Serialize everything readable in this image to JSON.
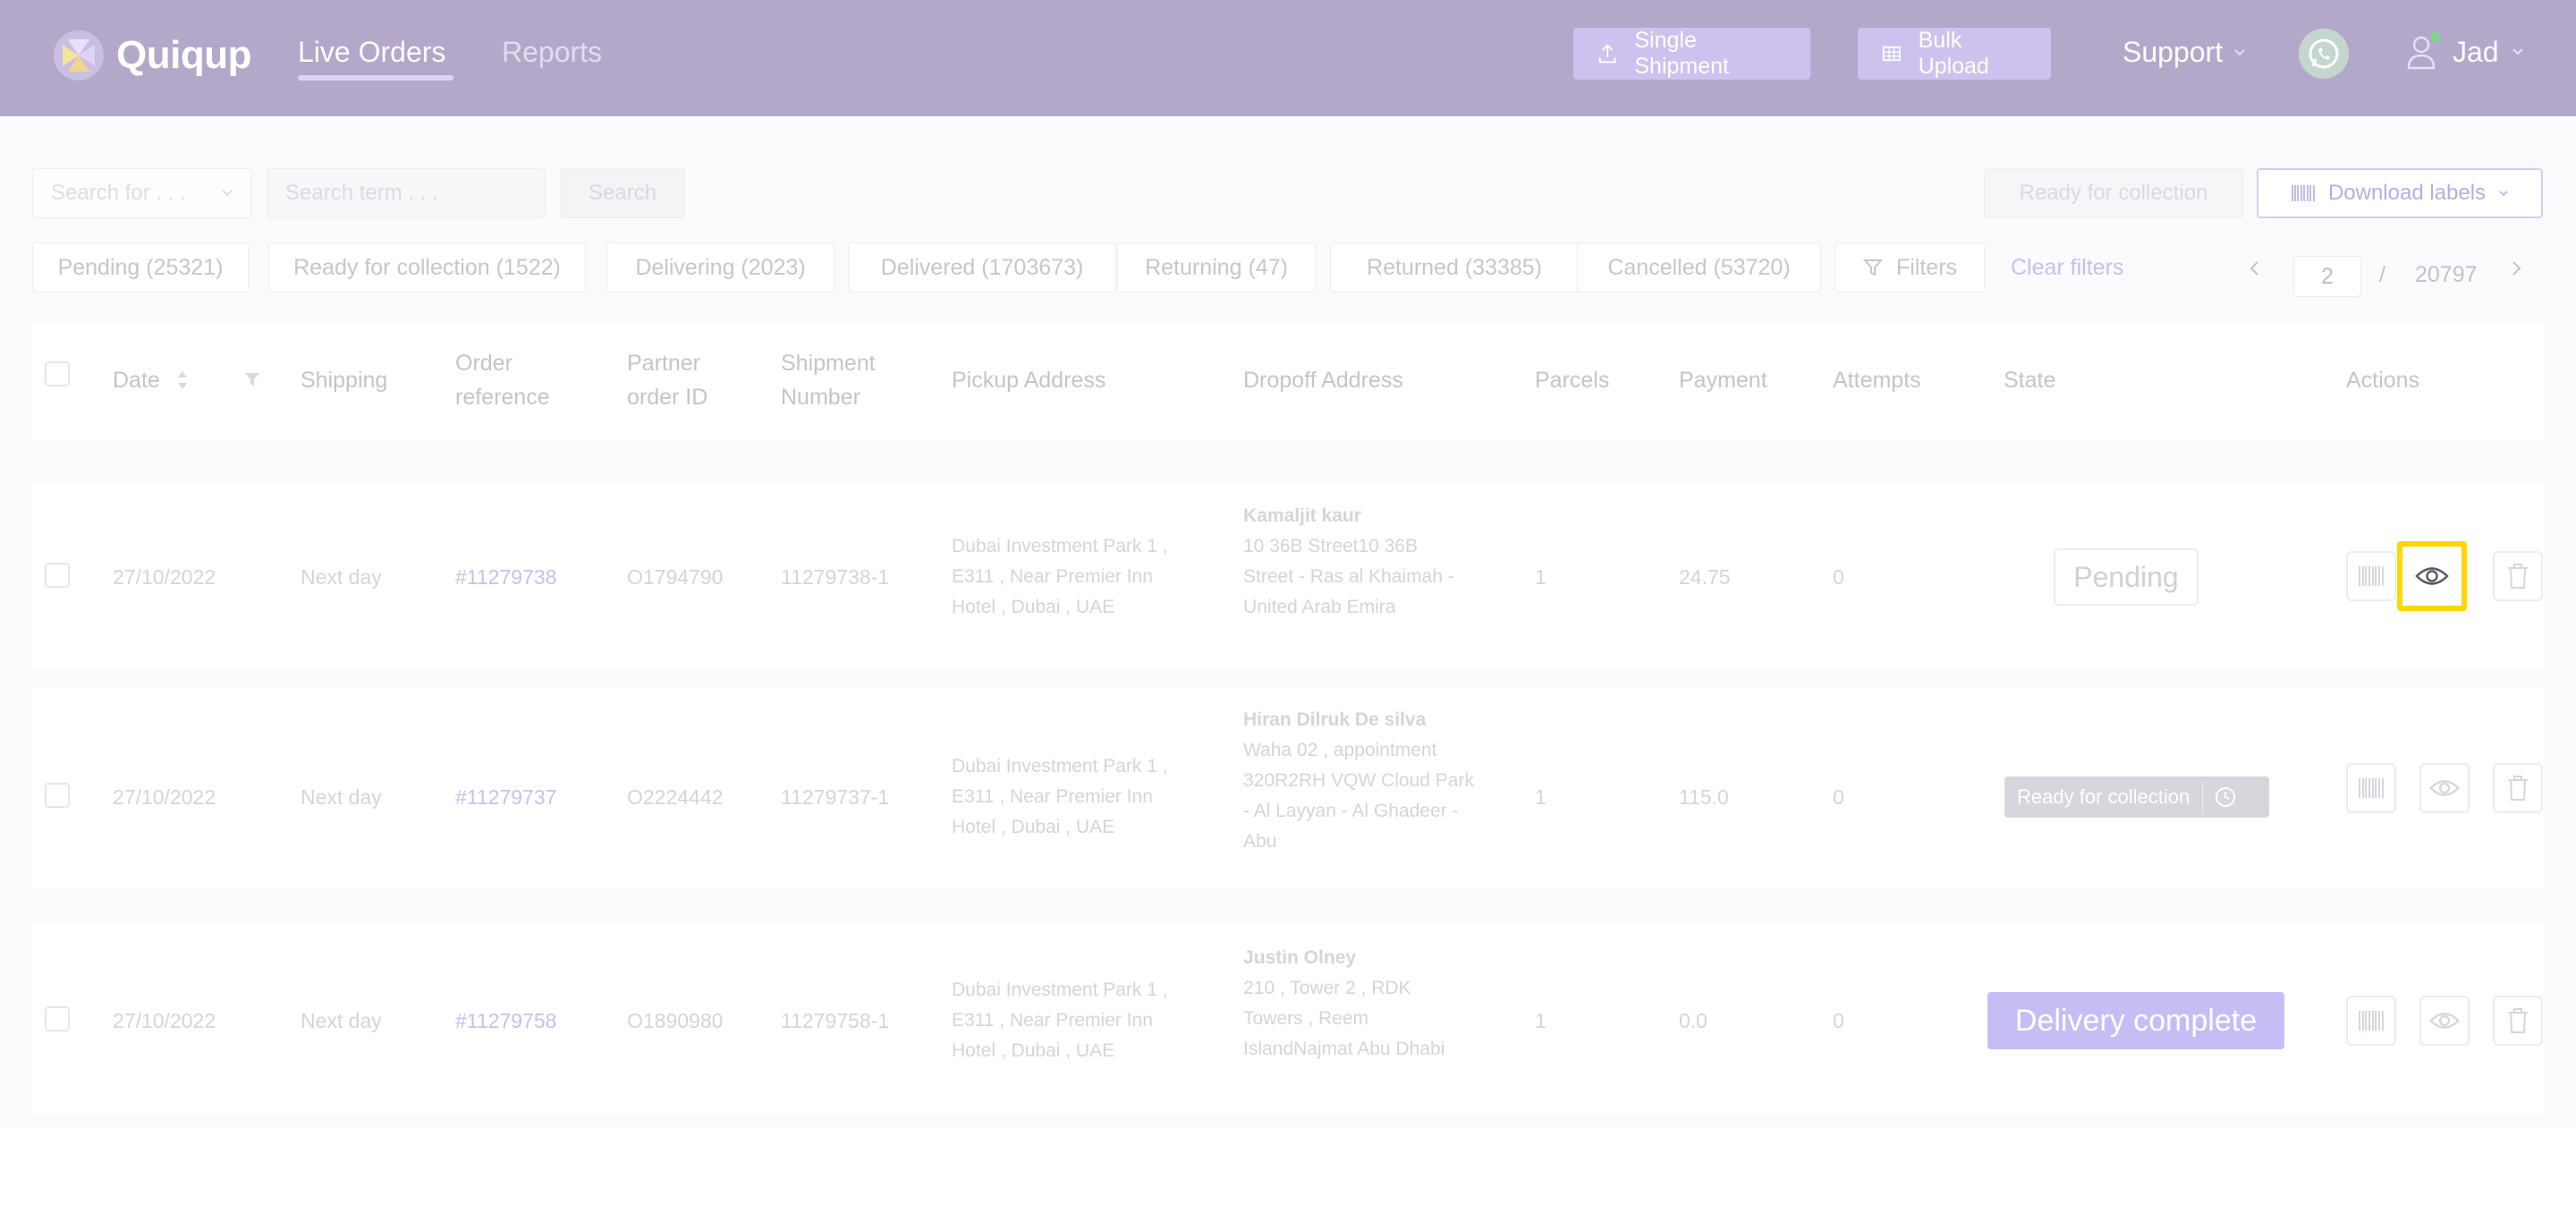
{
  "header": {
    "brand": "Quiqup",
    "nav": {
      "live_orders": "Live Orders",
      "reports": "Reports"
    },
    "single_shipment": "Single Shipment",
    "bulk_upload": "Bulk Upload",
    "support": "Support",
    "user_name": "Jad"
  },
  "toolbar": {
    "search_for_placeholder": "Search for . . .",
    "search_term_placeholder": "Search term . . .",
    "search_button": "Search",
    "ready_for_collection": "Ready for collection",
    "download_labels": "Download labels"
  },
  "status_chips": [
    "Pending (25321)",
    "Ready for collection (1522)",
    "Delivering (2023)",
    "Delivered (1703673)",
    "Returning (47)",
    "Returned (33385)",
    "Cancelled (53720)"
  ],
  "filters_label": "Filters",
  "clear_filters": "Clear filters",
  "pagination": {
    "current": "2",
    "separator": "/",
    "total": "20797"
  },
  "table": {
    "headers": {
      "date": "Date",
      "shipping": "Shipping",
      "order_reference_1": "Order",
      "order_reference_2": "reference",
      "partner_1": "Partner",
      "partner_2": "order ID",
      "shipment_1": "Shipment",
      "shipment_2": "Number",
      "pickup": "Pickup Address",
      "dropoff": "Dropoff Address",
      "parcels": "Parcels",
      "payment": "Payment",
      "attempts": "Attempts",
      "state": "State",
      "actions": "Actions"
    },
    "rows": [
      {
        "date": "27/10/2022",
        "shipping": "Next day",
        "order_ref": "#11279738",
        "partner_id": "O1794790",
        "shipment": "11279738-1",
        "pickup": [
          "Dubai Investment Park 1 ,",
          "E311 , Near Premier Inn",
          "Hotel , Dubai , UAE"
        ],
        "dropoff": [
          "Kamaljit kaur",
          "10 36B Street10 36B",
          "Street - Ras al Khaimah -",
          "United Arab Emira"
        ],
        "parcels": "1",
        "payment": "24.75",
        "attempts": "0",
        "state": "Pending"
      },
      {
        "date": "27/10/2022",
        "shipping": "Next day",
        "order_ref": "#11279737",
        "partner_id": "O2224442",
        "shipment": "11279737-1",
        "pickup": [
          "Dubai Investment Park 1 ,",
          "E311 , Near Premier Inn",
          "Hotel , Dubai , UAE"
        ],
        "dropoff": [
          "Hiran Dilruk De silva",
          "Waha 02 , appointment",
          "320R2RH VQW Cloud Park",
          "- Al Layyan - Al Ghadeer -",
          "Abu"
        ],
        "parcels": "1",
        "payment": "115.0",
        "attempts": "0",
        "state": "Ready for collection"
      },
      {
        "date": "27/10/2022",
        "shipping": "Next day",
        "order_ref": "#11279758",
        "partner_id": "O1890980",
        "shipment": "11279758-1",
        "pickup": [
          "Dubai Investment Park 1 ,",
          "E311 , Near Premier Inn",
          "Hotel , Dubai , UAE"
        ],
        "dropoff": [
          "Justin Olney",
          "210 , Tower 2 , RDK",
          "Towers , Reem",
          "IslandNajmat Abu Dhabi"
        ],
        "parcels": "1",
        "payment": "0.0",
        "attempts": "0",
        "state": "Delivery complete"
      }
    ]
  },
  "colors": {
    "header_bg": "#b3a8ca",
    "accent": "#c7bdf5",
    "highlight": "#ffd600"
  },
  "icons": [
    "upload-icon",
    "grid-icon",
    "chevron-down-icon",
    "whatsapp-icon",
    "user-icon",
    "barcode-icon",
    "filter-icon",
    "sort-icon",
    "eye-icon",
    "trash-icon",
    "clock-icon",
    "chevron-left-icon",
    "chevron-right-icon"
  ]
}
